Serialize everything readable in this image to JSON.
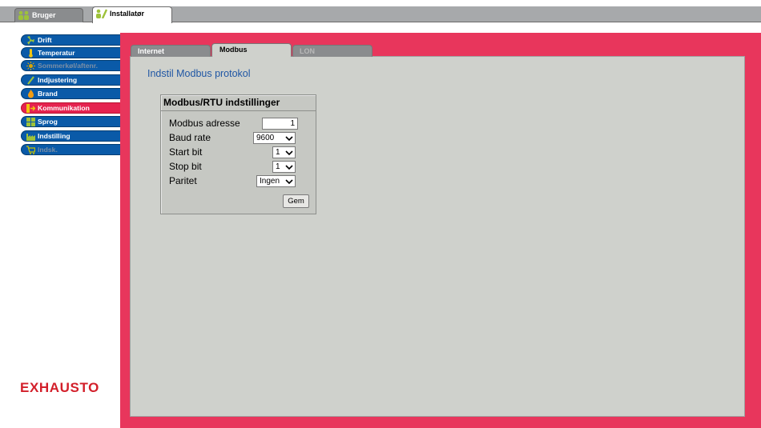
{
  "user_tabs": [
    {
      "label": "Bruger",
      "icon": "users-icon"
    },
    {
      "label": "Installatør",
      "icon": "installer-tools-icon"
    }
  ],
  "sidebar": {
    "items": [
      {
        "label": "Drift",
        "icon": "fan-icon",
        "state": "normal"
      },
      {
        "label": "Temperatur",
        "icon": "thermometer-icon",
        "state": "normal"
      },
      {
        "label": "Sommerkøl/aftenr.",
        "icon": "sun-icon",
        "state": "disabled"
      },
      {
        "label": "Indjustering",
        "icon": "wrench-icon",
        "state": "normal"
      },
      {
        "label": "Brand",
        "icon": "fire-icon",
        "state": "normal"
      },
      {
        "label": "Kommunikation",
        "icon": "communication-icon",
        "state": "active"
      },
      {
        "label": "Sprog",
        "icon": "language-grid-icon",
        "state": "normal"
      },
      {
        "label": "Indstilling",
        "icon": "factory-icon",
        "state": "normal"
      },
      {
        "label": "Indsk.",
        "icon": "cart-icon",
        "state": "disabled"
      }
    ],
    "logo_text": "EXHAUSTO"
  },
  "content_tabs": [
    {
      "label": "Internet",
      "state": "normal"
    },
    {
      "label": "Modbus",
      "state": "active"
    },
    {
      "label": "LON",
      "state": "disabled"
    }
  ],
  "page_heading": "Indstil Modbus protokol",
  "settings": {
    "title": "Modbus/RTU indstillinger",
    "fields": [
      {
        "label": "Modbus adresse",
        "value": "1",
        "kind": "input"
      },
      {
        "label": "Baud rate",
        "value": "9600",
        "kind": "select"
      },
      {
        "label": "Start bit",
        "value": "1",
        "kind": "select"
      },
      {
        "label": "Stop bit",
        "value": "1",
        "kind": "select"
      },
      {
        "label": "Paritet",
        "value": "Ingen",
        "kind": "select"
      }
    ],
    "save_label": "Gem"
  },
  "colors": {
    "accent_red": "#e8365c",
    "nav_blue": "#0a5aa8",
    "heading_blue": "#1f56a4",
    "logo_red": "#d31f2a",
    "panel_gray": "#cfd1cc"
  }
}
